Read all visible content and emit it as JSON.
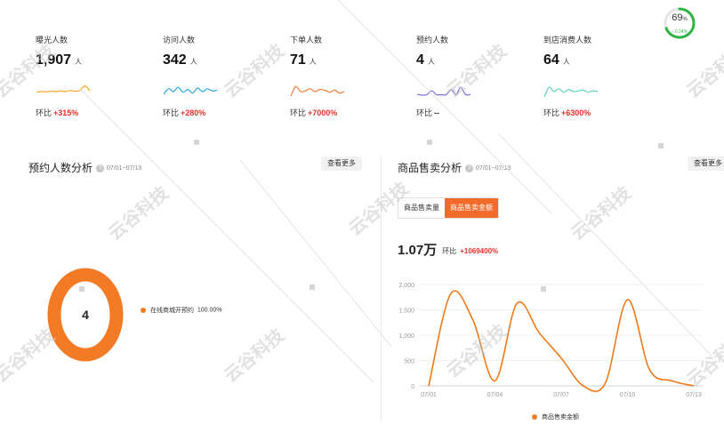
{
  "stats": [
    {
      "label": "曝光人数",
      "value": "1,907",
      "unit": "人",
      "ratio_label": "环比",
      "ratio": "+315%",
      "color": "#f5a623",
      "spark": [
        0.55,
        0.5,
        0.52,
        0.48,
        0.5,
        0.45,
        0.5,
        0.42,
        0.48,
        0.4,
        0.1,
        0.45
      ]
    },
    {
      "label": "访问人数",
      "value": "342",
      "unit": "人",
      "ratio_label": "环比",
      "ratio": "+280%",
      "color": "#2aa6e0",
      "spark": [
        0.7,
        0.3,
        0.5,
        0.2,
        0.55,
        0.35,
        0.6,
        0.25,
        0.5,
        0.3,
        0.45,
        0.4
      ]
    },
    {
      "label": "下单人数",
      "value": "71",
      "unit": "人",
      "ratio_label": "环比",
      "ratio": "+7000%",
      "color": "#f07a3a",
      "spark": [
        0.8,
        0.15,
        0.5,
        0.45,
        0.3,
        0.5,
        0.35,
        0.4,
        0.55,
        0.4,
        0.6,
        0.5
      ]
    },
    {
      "label": "预约人数",
      "value": "4",
      "unit": "人",
      "ratio_label": "环比",
      "ratio": "--",
      "color": "#7b6cd9",
      "spark": [
        0.7,
        0.75,
        0.72,
        0.45,
        0.72,
        0.72,
        0.72,
        0.35,
        0.72,
        0.2,
        0.72,
        0.7
      ]
    },
    {
      "label": "到店消费人数",
      "value": "64",
      "unit": "人",
      "ratio_label": "环比",
      "ratio": "+6300%",
      "color": "#5fd3c0",
      "spark": [
        0.85,
        0.2,
        0.5,
        0.3,
        0.55,
        0.35,
        0.5,
        0.45,
        0.4,
        0.55,
        0.45,
        0.5
      ]
    }
  ],
  "ring": {
    "value": "69",
    "unit": "%",
    "sub": "↑ 0.24%",
    "percent": 69,
    "color": "#2fb344"
  },
  "booking": {
    "title": "预约人数分析",
    "date_range": "07/01~07/13",
    "more_label": "查看更多",
    "total": "4",
    "legend_label": "在线商城开预约",
    "legend_value": "100.00%",
    "color": "#f47b26"
  },
  "sales": {
    "title": "商品售卖分析",
    "date_range": "07/01~07/13",
    "more_label": "查看更多",
    "tabs": [
      {
        "label": "商品售卖量",
        "active": false
      },
      {
        "label": "商品售卖金额",
        "active": true
      }
    ],
    "total": "1.07万",
    "ratio_label": "环比",
    "ratio": "+1069400%",
    "legend_label": "商品售卖金额",
    "color": "#f07a1a"
  },
  "chart_data": {
    "type": "line",
    "x": [
      "07/01",
      "07/02",
      "07/03",
      "07/04",
      "07/05",
      "07/06",
      "07/07",
      "07/08",
      "07/09",
      "07/10",
      "07/11",
      "07/12",
      "07/13"
    ],
    "xticks": [
      "07/01",
      "07/04",
      "07/07",
      "07/10",
      "07/13"
    ],
    "yticks": [
      "0",
      "500",
      "1,000",
      "1,500",
      "2,000"
    ],
    "ylim": [
      0,
      2000
    ],
    "series": [
      {
        "name": "商品售卖金额",
        "values": [
          0,
          1820,
          1300,
          100,
          1630,
          1050,
          550,
          0,
          60,
          1700,
          320,
          100,
          0
        ]
      }
    ]
  },
  "watermark": "云谷科技"
}
